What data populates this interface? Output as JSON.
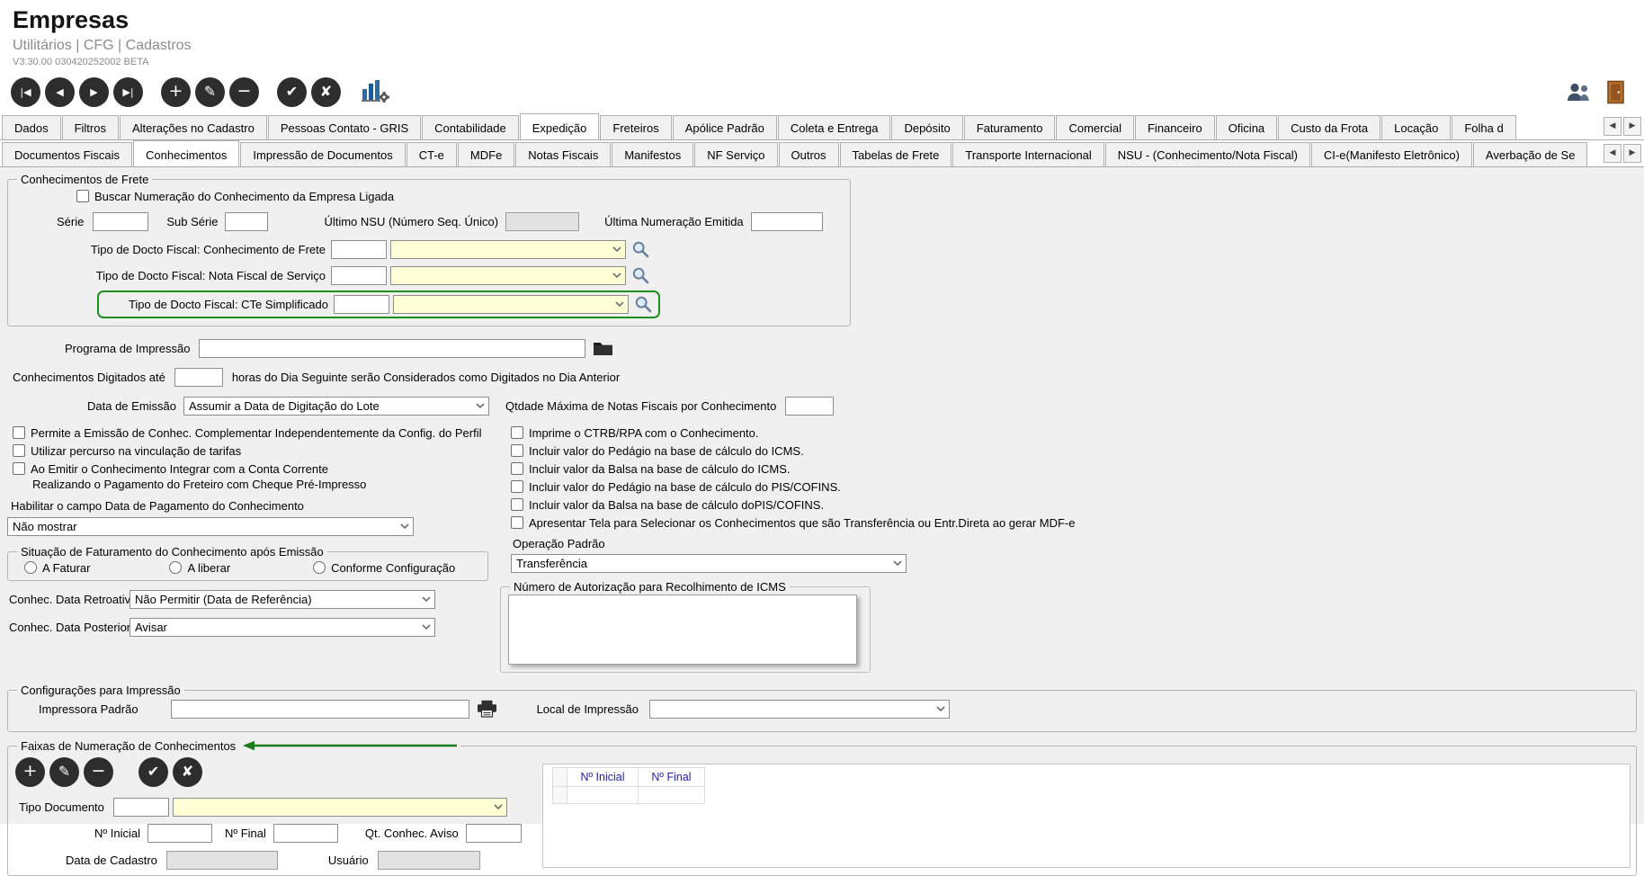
{
  "header": {
    "title": "Empresas",
    "breadcrumb": "Utilitários | CFG | Cadastros",
    "version": "V3.30.00 030420252002 BETA"
  },
  "icons": {
    "first": "|◀",
    "prior": "◀",
    "next": "▶",
    "last": "▶|",
    "insert": "+",
    "edit": "✎",
    "delete": "−",
    "confirm": "✔",
    "cancel": "✘",
    "scroll_left": "◀",
    "scroll_right": "▶"
  },
  "tabs_main": [
    "Dados",
    "Filtros",
    "Alterações no Cadastro",
    "Pessoas Contato - GRIS",
    "Contabilidade",
    "Expedição",
    "Freteiros",
    "Apólice Padrão",
    "Coleta e Entrega",
    "Depósito",
    "Faturamento",
    "Comercial",
    "Financeiro",
    "Oficina",
    "Custo da Frota",
    "Locação",
    "Folha d"
  ],
  "tabs_sub": [
    "Documentos Fiscais",
    "Conhecimentos",
    "Impressão de Documentos",
    "CT-e",
    "MDFe",
    "Notas Fiscais",
    "Manifestos",
    "NF Serviço",
    "Outros",
    "Tabelas de Frete",
    "Transporte Internacional",
    "NSU - (Conhecimento/Nota Fiscal)",
    "CI-e(Manifesto Eletrônico)",
    "Averbação de Se"
  ],
  "conhecimentos_frete": {
    "legend": "Conhecimentos de Frete",
    "buscar_numeracao": "Buscar Numeração do Conhecimento da Empresa Ligada",
    "serie_label": "Série",
    "serie_value": "",
    "sub_serie_label": "Sub Série",
    "sub_serie_value": "",
    "ultimo_nsu_label": "Último NSU (Número Seq. Único)",
    "ultimo_nsu_value": "",
    "ultima_numeracao_label": "Última Numeração Emitida",
    "ultima_numeracao_value": "",
    "tipo_conhecimento_label": "Tipo de Docto Fiscal: Conhecimento de Frete",
    "tipo_conhecimento_code": "",
    "tipo_conhecimento_desc": "",
    "tipo_nota_servico_label": "Tipo de Docto Fiscal: Nota Fiscal de Serviço",
    "tipo_nota_servico_code": "",
    "tipo_nota_servico_desc": "",
    "tipo_cte_simplificado_label": "Tipo de Docto Fiscal: CTe Simplificado",
    "tipo_cte_simplificado_code": "",
    "tipo_cte_simplificado_desc": ""
  },
  "programa_impressao": {
    "label": "Programa de Impressão",
    "value": ""
  },
  "digitados": {
    "label": "Conhecimentos Digitados até",
    "value": "",
    "suffix": "horas do Dia Seguinte serão Considerados como Digitados no Dia Anterior"
  },
  "data_emissao": {
    "label": "Data de Emissão",
    "value": "Assumir a Data de Digitação do Lote",
    "qtd_label": "Qtdade Máxima de Notas Fiscais por Conhecimento",
    "qtd_value": ""
  },
  "opcoes_esquerda": {
    "cb_complementar": "Permite a Emissão de Conhec. Complementar Independentemente da Config. do Perfil",
    "cb_percurso": "Utilizar percurso na vinculação de tarifas",
    "cb_conta_corrente": "Ao Emitir o Conhecimento Integrar com a Conta Corrente",
    "cb_conta_corrente_l2": "Realizando o Pagamento do Freteiro com Cheque Pré-Impresso",
    "habilitar_label": "Habilitar o campo Data de Pagamento do Conhecimento",
    "habilitar_value": "Não mostrar"
  },
  "opcoes_direita": {
    "cb_ctrb": "Imprime o CTRB/RPA com o Conhecimento.",
    "cb_pedagio_icms": "Incluir valor do Pedágio na base de cálculo do ICMS.",
    "cb_balsa_icms": "Incluir valor da Balsa na base de cálculo do ICMS.",
    "cb_pedagio_pis": "Incluir valor do Pedágio na base de cálculo do PIS/COFINS.",
    "cb_balsa_pis": "Incluir valor da Balsa na base de cálculo doPIS/COFINS.",
    "cb_apresentar_tela": "Apresentar Tela para Selecionar os Conhecimentos que são Transferência ou Entr.Direta ao gerar MDF-e",
    "operacao_label": "Operação Padrão",
    "operacao_value": "Transferência"
  },
  "situacao_faturamento": {
    "legend": "Situação de Faturamento do Conhecimento após Emissão",
    "opt_a_faturar": "A Faturar",
    "opt_a_liberar": "A liberar",
    "opt_conforme": "Conforme Configuração"
  },
  "datas_conhecimento": {
    "retroativa_label": "Conhec. Data Retroativa",
    "retroativa_value": "Não Permitir (Data de Referência)",
    "posterior_label": "Conhec. Data Posterior",
    "posterior_value": "Avisar"
  },
  "autorizacao_icms": {
    "legend": "Número de Autorização para Recolhimento de ICMS",
    "value": ""
  },
  "config_impressao": {
    "legend": "Configurações para Impressão",
    "impressora_label": "Impressora Padrão",
    "impressora_value": "",
    "local_label": "Local de Impressão",
    "local_value": ""
  },
  "faixas": {
    "legend": "Faixas de Numeração de Conhecimentos",
    "tipo_documento_label": "Tipo Documento",
    "tipo_documento_code": "",
    "tipo_documento_desc": "",
    "no_inicial_label": "Nº Inicial",
    "no_inicial_value": "",
    "no_final_label": "Nº Final",
    "no_final_value": "",
    "qt_aviso_label": "Qt. Conhec. Aviso",
    "qt_aviso_value": "",
    "data_cadastro_label": "Data de Cadastro",
    "data_cadastro_value": "",
    "usuario_label": "Usuário",
    "usuario_value": "",
    "grid_headers": [
      "Nº Inicial",
      "Nº Final"
    ]
  }
}
